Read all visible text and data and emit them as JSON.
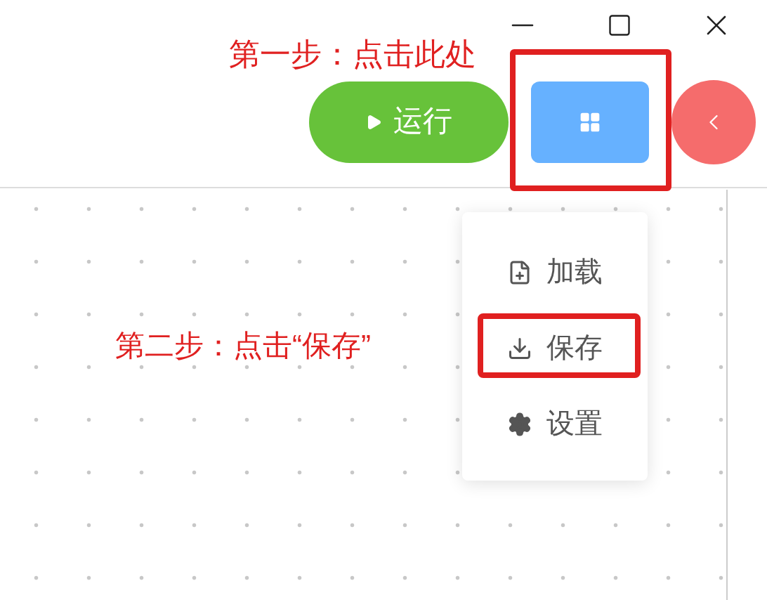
{
  "toolbar": {
    "run_button": {
      "label": "运行"
    }
  },
  "menu": {
    "items": [
      {
        "kind": "load",
        "label": "加载"
      },
      {
        "kind": "save",
        "label": "保存"
      },
      {
        "kind": "settings",
        "label": "设置"
      }
    ]
  },
  "annotations": [
    {
      "text": "第一步：点击此处"
    },
    {
      "text": "第二步：点击“保存”"
    }
  ]
}
